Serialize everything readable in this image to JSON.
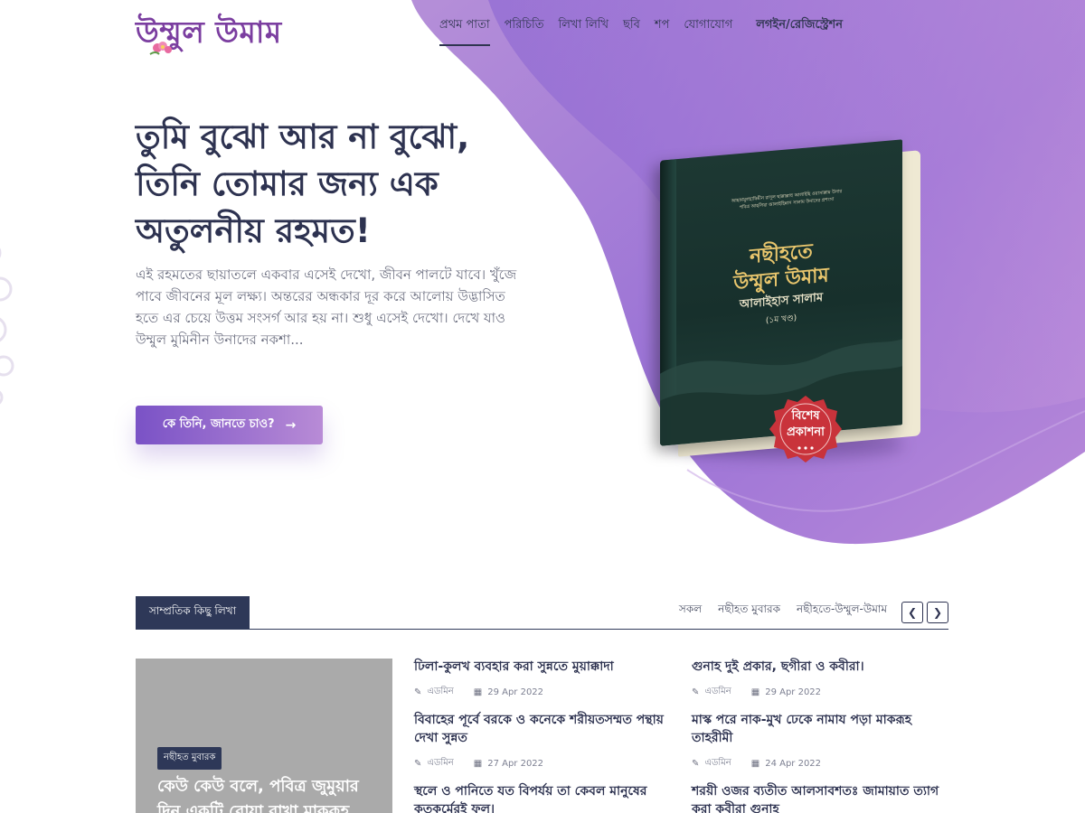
{
  "brand": {
    "logo_text": "উম্মুল উমাম",
    "primary": "#7b3ea0",
    "accent_gradient": [
      "#7a52c6",
      "#b88bd6"
    ],
    "dark": "#2e3858"
  },
  "nav": {
    "items": [
      "প্রথম পাতা",
      "পরিচিতি",
      "লিখা লিখি",
      "ছবি",
      "শপ",
      "যোগাযোগ"
    ],
    "active_index": 0,
    "login": "লগইন/রেজিস্ট্রেশন"
  },
  "hero": {
    "title_lines": [
      "তুমি বুঝো আর না বুঝো,",
      "তিনি তোমার জন্য এক",
      "অতুলনীয় রহমত!"
    ],
    "text": "এই রহমতের ছায়াতলে একবার এসেই দেখো, জীবন পালটে যাবে। খুঁজে পাবে জীবনের মূল লক্ষ্য। অন্তরের অন্ধকার দূর করে আলোয় উদ্ভাসিত হতে এর চেয়ে উত্তম সংসর্গ আর হয় না। শুধু এসেই দেখো। দেখে যাও উম্মুল মুমিনীন উনাদের নকশা...",
    "cta_label": "কে তিনি, জানতে চাও?",
    "cta_icon": "arrow-right-icon"
  },
  "book": {
    "small_lines": [
      "আহকামুলহাকিমীন রাসূল ছাল্লাল্লাহু আলাইহি ওয়াসাল্লাম উনার",
      "পবিত্র আহলিয়া আলাইহিন্নাস সালাম উনাদের প্রশংসা"
    ],
    "title_line1": "নছীহতে",
    "title_line2": "উম্মুল উমাম",
    "subtitle": "আলাইহাস সালাম",
    "volume": "(১ম খণ্ড)",
    "seal_line1": "বিশেষ",
    "seal_line2": "প্রকাশনা"
  },
  "recent": {
    "tab_label": "সাম্প্রতিক কিছু লিখা",
    "filters": [
      "সকল",
      "নছীহত মুবারক",
      "নছীহতে-উম্মুল-উমাম"
    ],
    "prev_icon": "chevron-left-icon",
    "next_icon": "chevron-right-icon",
    "feature": {
      "badge": "নছীহত মুবারক",
      "title": "কেউ কেউ বলে, পবিত্র জুমুয়ার দিন একটি রোযা রাখা মাকরূহ"
    },
    "posts": [
      {
        "title": "ঢিলা-কুলখ ব্যবহার করা সুন্নতে মুয়াক্কাদা",
        "author": "এডমিন",
        "date": "29 Apr 2022"
      },
      {
        "title": "বিবাহের পূর্বে বরকে ও কনেকে শরীয়তসম্মত পন্থায় দেখা সুন্নত",
        "author": "এডমিন",
        "date": "27 Apr 2022"
      },
      {
        "title": "স্থলে ও পানিতে যত বিপর্যয় তা কেবল মানুষের কৃতকর্মেরই ফল।",
        "author": "",
        "date": ""
      },
      {
        "title": "গুনাহ দুই প্রকার, ছগীরা ও কবীরা।",
        "author": "এডমিন",
        "date": "29 Apr 2022"
      },
      {
        "title": "মাস্ক পরে নাক-মুখ ঢেকে নামায পড়া মাকরূহ তাহরীমী",
        "author": "এডমিন",
        "date": "24 Apr 2022"
      },
      {
        "title": "শরয়ী ওজর ব্যতীত আলসাবশতঃ জামায়াত ত্যাগ করা কবীরা গুনাহ",
        "author": "",
        "date": ""
      }
    ]
  }
}
